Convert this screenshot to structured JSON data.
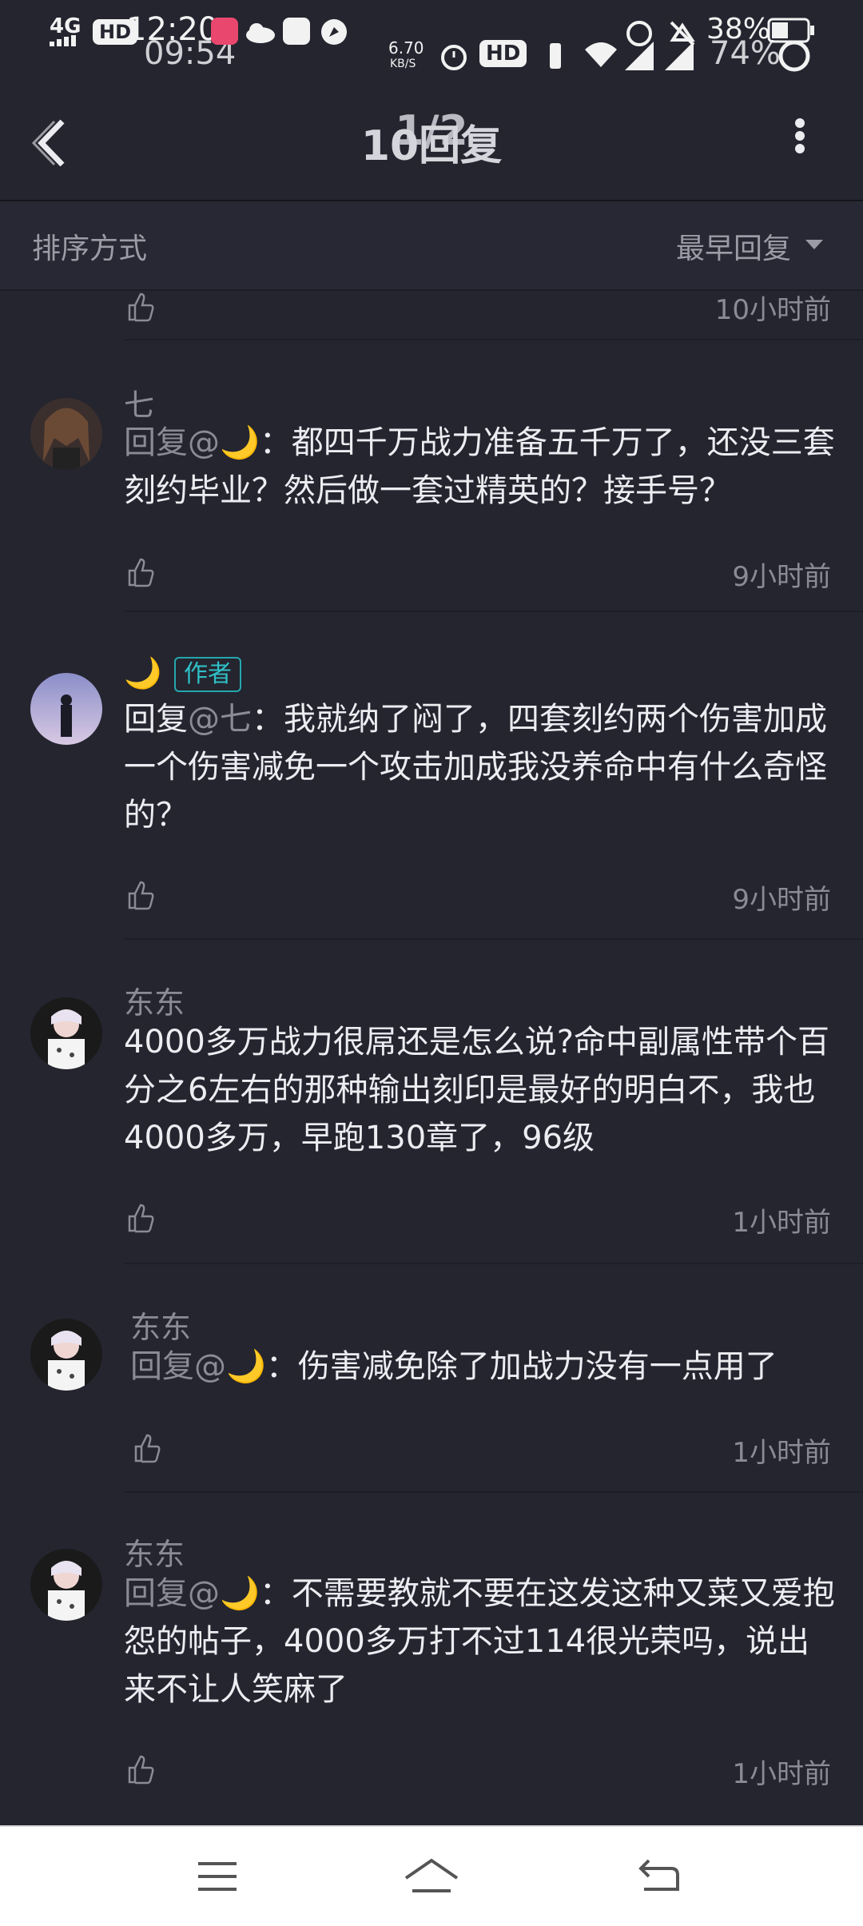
{
  "status_bar": {
    "left_signal": "4G",
    "badge_hd": "HD",
    "time_top": "12:20",
    "time_bottom": "09:54",
    "net_speed": "6.70",
    "net_unit": "KB/S",
    "hd_badge": "HD",
    "battery_percent_top": "38%",
    "battery_percent_bottom": "74%"
  },
  "header": {
    "back_icon": "chevron-left-icon",
    "title_bottom": "10回复",
    "title_top": "1/2",
    "more_icon": "more-vertical-icon"
  },
  "sort": {
    "label": "排序方式",
    "value": "最早回复"
  },
  "comments": [
    {
      "time": "10小时前"
    },
    {
      "name": "七",
      "reply_prefix": "回复@",
      "reply_target": "🌙",
      "text": "：都四千万战力准备五千万了，还没三套刻约毕业？然后做一套过精英的？接手号？",
      "time": "9小时前"
    },
    {
      "name": "🌙",
      "badge": "作者",
      "reply_prefix": "回复",
      "reply_target": "@七",
      "text": "：我就纳了闷了，四套刻约两个伤害加成一个伤害减免一个攻击加成我没养命中有什么奇怪的？",
      "time": "9小时前"
    },
    {
      "name": "东东",
      "text": "4000多万战力很屌还是怎么说?命中副属性带个百分之6左右的那种输出刻印是最好的明白不，我也4000多万，早跑130章了，96级",
      "time": "1小时前"
    },
    {
      "name": "东东",
      "reply_prefix": "回复@",
      "reply_target": "🌙",
      "text": "：伤害减免除了加战力没有一点用了",
      "time": "1小时前"
    },
    {
      "name": "东东",
      "reply_prefix": "回复@",
      "reply_target": "🌙",
      "text": "：不需要教就不要在这发这种又菜又爱抱怨的帖子，4000多万打不过114很光荣吗，说出来不让人笑麻了",
      "time": "1小时前"
    }
  ],
  "system_nav": {
    "menu_icon": "menu-icon",
    "home_icon": "home-icon",
    "back_icon": "back-icon"
  }
}
